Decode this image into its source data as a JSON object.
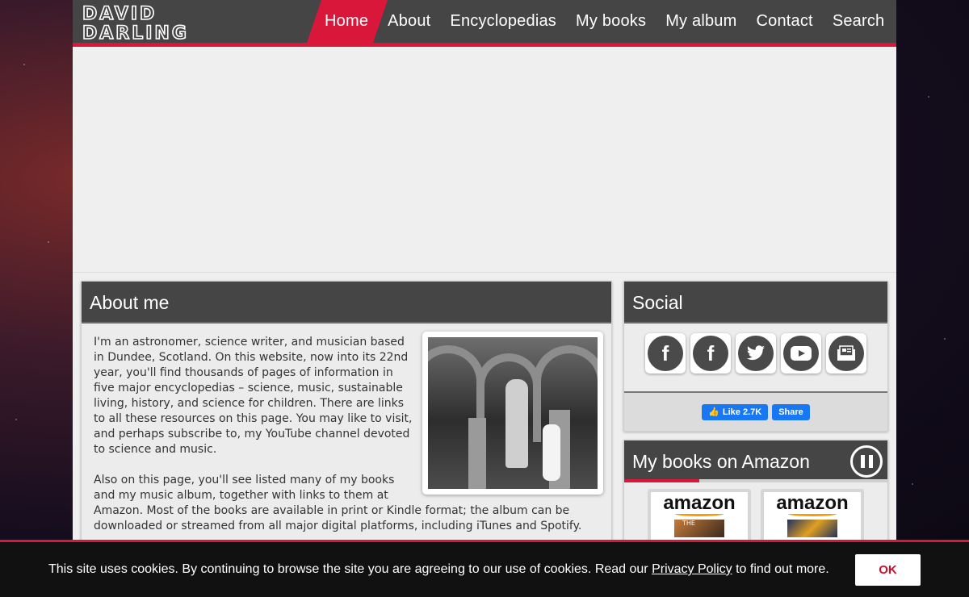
{
  "logo": {
    "line1": "DAVID",
    "line2": "DARLING"
  },
  "nav": {
    "items": [
      "Home",
      "About",
      "Encyclopedias",
      "My books",
      "My album",
      "Contact",
      "Search"
    ],
    "active": "Home"
  },
  "about": {
    "title": "About me",
    "paragraph1": "I'm an astronomer, science writer, and musician based in Dundee, Scotland. On this website, now into its 22nd year, you'll find thousands of pages of information in five major encyclopedias – science, music, sustainable living, history, and science for children. There are links to all these resources on this page. You may like to visit, and perhaps subscribe to, my YouTube channel devoted to science and music.",
    "paragraph2": "Also on this page, you'll see listed many of my books and my music album, together with links to them at Amazon. Most of the books are available in print or Kindle format; the album can be downloaded or streamed from all major digital platforms, including iTunes and Spotify."
  },
  "social": {
    "title": "Social",
    "icons": [
      "facebook-icon",
      "facebook-icon",
      "twitter-icon",
      "youtube-icon",
      "newsletter-icon"
    ],
    "like_label": "Like 2.7K",
    "share_label": "Share"
  },
  "amazon": {
    "title": "My books on Amazon",
    "brand": "amazon",
    "book1_cover_text": "THE"
  },
  "cookie": {
    "text_before": "This site uses cookies. By continuing to browse the site you are agreeing to our use of cookies. Read our ",
    "link": "Privacy Policy",
    "text_after": " to find out more.",
    "ok": "OK"
  },
  "colors": {
    "accent": "#d9173a",
    "header": "#454545",
    "page": "#efefef"
  }
}
